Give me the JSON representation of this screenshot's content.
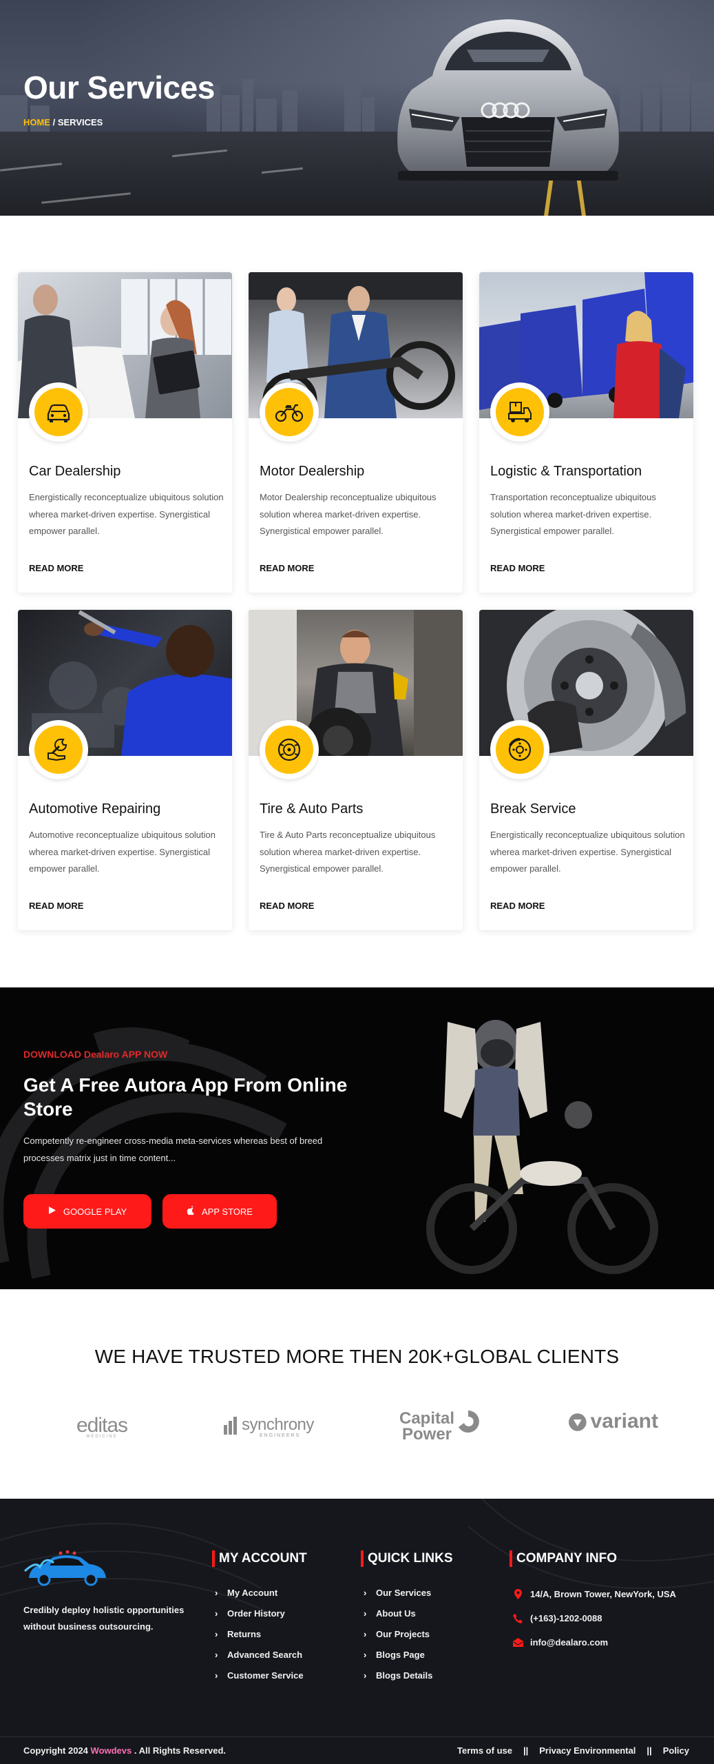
{
  "hero": {
    "title": "Our Services",
    "breadcrumb_home": "HOME",
    "breadcrumb_sep": " / ",
    "breadcrumb_current": "SERVICES"
  },
  "services": [
    {
      "title": "Car Dealership",
      "text": "Energistically reconceptualize ubiquitous solution wherea market-driven expertise. Synergistical empower parallel.",
      "more": "READ MORE",
      "icon": "car-icon"
    },
    {
      "title": "Motor Dealership",
      "text": "Motor Dealership reconceptualize ubiquitous solution wherea market-driven expertise. Synergistical empower parallel.",
      "more": "READ MORE",
      "icon": "motorcycle-icon"
    },
    {
      "title": "Logistic & Transportation",
      "text": "Transportation reconceptualize ubiquitous solution wherea market-driven expertise. Synergistical empower parallel.",
      "more": "READ MORE",
      "icon": "delivery-truck-icon"
    },
    {
      "title": "Automotive Repairing",
      "text": "Automotive reconceptualize ubiquitous solution wherea market-driven expertise. Synergistical empower parallel.",
      "more": "READ MORE",
      "icon": "wrench-hand-icon"
    },
    {
      "title": "Tire & Auto Parts",
      "text": "Tire & Auto Parts reconceptualize ubiquitous solution wherea market-driven expertise. Synergistical empower parallel.",
      "more": "READ MORE",
      "icon": "tire-icon"
    },
    {
      "title": "Break Service",
      "text": "Energistically reconceptualize ubiquitous solution wherea market-driven expertise. Synergistical empower parallel.",
      "more": "READ MORE",
      "icon": "brake-disc-icon"
    }
  ],
  "app": {
    "tag": "DOWNLOAD Dealaro APP NOW",
    "title": "Get A Free Autora App From Online Store",
    "text": "Competently re-engineer cross-media meta-services whereas best of breed processes matrix just in time content...",
    "google_play": "GOOGLE PLAY",
    "app_store": "APP STORE",
    "accent": "#ff1a1a"
  },
  "clients": {
    "title": "WE HAVE TRUSTED MORE THEN 20K+GLOBAL CLIENTS",
    "logos": [
      {
        "name": "editas",
        "sub": "MEDICINE"
      },
      {
        "name": "synchrony",
        "sub": "ENGINEERS"
      },
      {
        "name": "Capital",
        "sub": "Power"
      },
      {
        "name": "variant",
        "sub": ""
      }
    ]
  },
  "footer": {
    "description": "Credibly deploy holistic opportunities without business outsourcing.",
    "my_account": {
      "title": "MY ACCOUNT",
      "items": [
        "My Account",
        "Order History",
        "Returns",
        "Advanced Search",
        "Customer Service"
      ]
    },
    "quick_links": {
      "title": "QUICK LINKS",
      "items": [
        "Our Services",
        "About Us",
        "Our Projects",
        "Blogs Page",
        "Blogs Details"
      ]
    },
    "company_info": {
      "title": "COMPANY INFO",
      "address": "14/A, Brown Tower, NewYork, USA",
      "phone": "(+163)-1202-0088",
      "email": "info@dealaro.com"
    },
    "copyright_prefix": "Copyright 2024 ",
    "copyright_brand": "Wowdevs",
    "copyright_suffix": " . All Rights Reserved.",
    "terms": "Terms of use",
    "privacy": "Privacy Environmental",
    "policy": "Policy",
    "separator": "||"
  }
}
